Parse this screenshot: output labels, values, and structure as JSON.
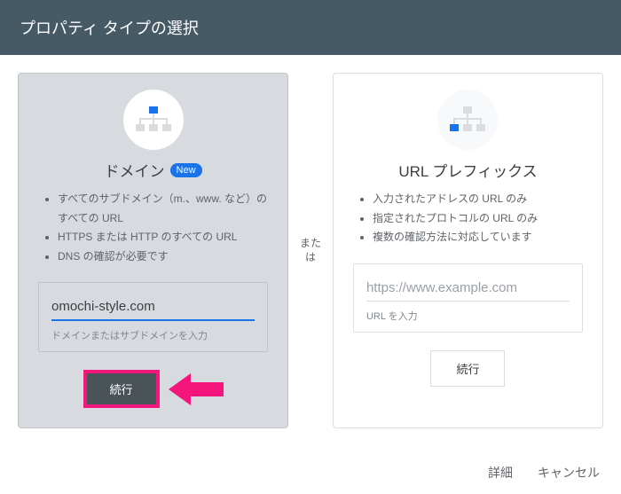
{
  "header": {
    "title": "プロパティ タイプの選択"
  },
  "separator": "または",
  "cards": {
    "domain": {
      "title": "ドメイン",
      "badge": "New",
      "bullets": [
        "すべてのサブドメイン（m.、www. など）のすべての URL",
        "HTTPS または HTTP のすべての URL",
        "DNS の確認が必要です"
      ],
      "input_value": "omochi-style.com",
      "helper": "ドメインまたはサブドメインを入力",
      "button": "続行"
    },
    "url": {
      "title": "URL プレフィックス",
      "bullets": [
        "入力されたアドレスの URL のみ",
        "指定されたプロトコルの URL のみ",
        "複数の確認方法に対応しています"
      ],
      "placeholder": "https://www.example.com",
      "helper": "URL を入力",
      "button": "続行"
    }
  },
  "footer": {
    "details": "詳細",
    "cancel": "キャンセル"
  }
}
